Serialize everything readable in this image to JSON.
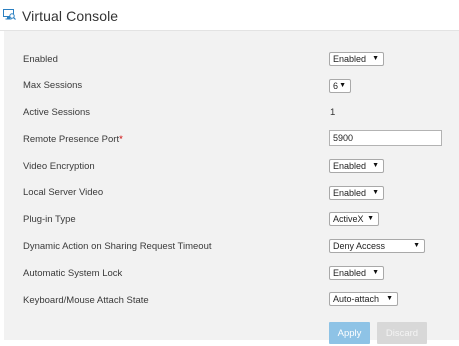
{
  "header": {
    "title": "Virtual Console",
    "icon": "virtual-console-icon"
  },
  "rows": {
    "enabled": {
      "label": "Enabled",
      "value": "Enabled"
    },
    "max_sessions": {
      "label": "Max Sessions",
      "value": "6"
    },
    "active_sessions": {
      "label": "Active Sessions",
      "value": "1"
    },
    "remote_port": {
      "label": "Remote Presence Port",
      "required_marker": "*",
      "value": "5900"
    },
    "video_encryption": {
      "label": "Video Encryption",
      "value": "Enabled"
    },
    "local_server_video": {
      "label": "Local Server Video",
      "value": "Enabled"
    },
    "plugin_type": {
      "label": "Plug-in Type",
      "value": "ActiveX"
    },
    "dynamic_action": {
      "label": "Dynamic Action on Sharing Request Timeout",
      "value": "Deny Access"
    },
    "system_lock": {
      "label": "Automatic System Lock",
      "value": "Enabled"
    },
    "attach_state": {
      "label": "Keyboard/Mouse Attach State",
      "value": "Auto-attach"
    }
  },
  "caret": "▼",
  "buttons": {
    "apply": "Apply",
    "discard": "Discard"
  },
  "colors": {
    "panel_bg": "#f2f2f2",
    "apply_bg": "#8ec3e6",
    "discard_bg": "#d8d8d8",
    "required": "#cc0000",
    "icon": "#2a7fc1"
  }
}
